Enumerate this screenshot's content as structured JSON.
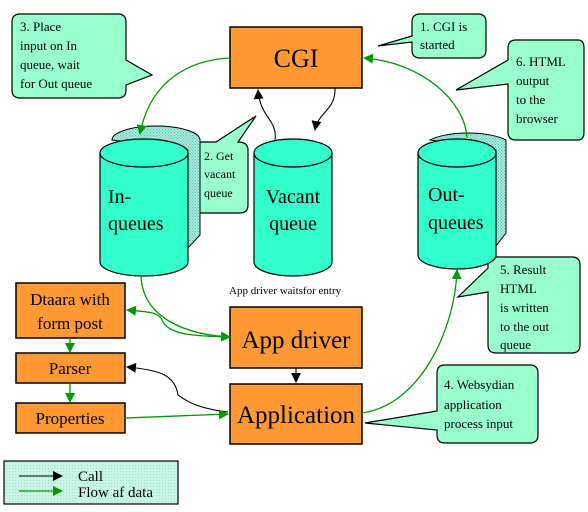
{
  "boxes": {
    "cgi": "CGI",
    "app_driver": "App driver",
    "application": "Application",
    "dtaara_line1": "Dtaara with",
    "dtaara_line2": "form post",
    "parser": "Parser",
    "properties": "Properties"
  },
  "queues": {
    "in_line1": "In-",
    "in_line2": "queues",
    "vacant_line1": "Vacant",
    "vacant_line2": "queue",
    "out_line1": "Out-",
    "out_line2": "queues"
  },
  "callouts": {
    "step1": [
      "1. CGI is",
      "started"
    ],
    "step2": [
      "2. Get",
      "vacant",
      "queue"
    ],
    "step3": [
      "3. Place",
      "input on In",
      "queue, wait",
      "for Out queue"
    ],
    "step4": [
      "4. Websydian",
      "application",
      "process input"
    ],
    "step5": [
      "5. Result",
      "HTML",
      "is written",
      "to the out",
      "queue"
    ],
    "step6": [
      "6. HTML",
      "output",
      "to the",
      "browser"
    ]
  },
  "annotation": "App driver waitsfor entry",
  "legend": {
    "call": "Call",
    "flow": "Flow af data"
  },
  "colors": {
    "process_box": "#ff9933",
    "queue": "#33ffcc",
    "callout": "#99ffcc",
    "call_arrow": "#000000",
    "data_flow_arrow": "#009900"
  }
}
